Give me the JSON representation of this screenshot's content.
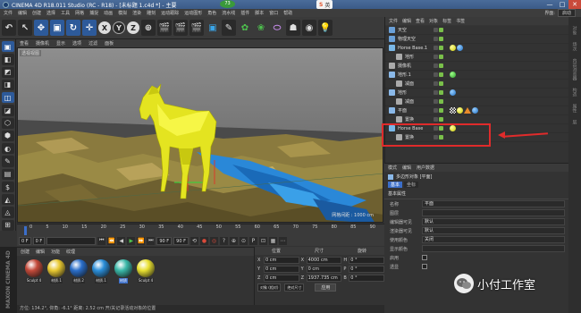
{
  "app": {
    "title": "CINEMA 4D R18.011 Studio (RC - R18) - [未标题 1.c4d *] - 主要",
    "fps_badge": "73"
  },
  "sogou": {
    "logo": "S",
    "lang": "英"
  },
  "window_buttons": {
    "minimize": "—",
    "maximize": "□",
    "close": "✕"
  },
  "menubar": {
    "items": [
      "文件",
      "编辑",
      "创建",
      "选择",
      "工具",
      "网格",
      "捕捉",
      "动画",
      "模拟",
      "渲染",
      "雕刻",
      "运动跟踪",
      "运动图形",
      "角色",
      "流水线",
      "插件",
      "脚本",
      "窗口",
      "帮助"
    ],
    "layout_label": "界面:",
    "layout_value": "启动"
  },
  "toolbar": {
    "buttons": [
      "↶",
      "↖",
      "✥",
      "▣",
      "↻",
      "✛",
      "X",
      "Y",
      "Z",
      "⊕",
      "🎬",
      "🎬",
      "🎬",
      "▣",
      "✎",
      "✿",
      "❀",
      "⬭",
      "☗",
      "◉",
      "💡"
    ]
  },
  "leftbar": {
    "icons": [
      "▣",
      "◧",
      "◩",
      "◨",
      "◫",
      "◪",
      "⬡",
      "⬢",
      "◐",
      "✎",
      "▤",
      "$",
      "◭",
      "◬",
      "⊞"
    ]
  },
  "viewport": {
    "menu": [
      "查看",
      "摄像机",
      "显示",
      "选项",
      "过滤",
      "面板"
    ],
    "label": "透视视图",
    "grid_info": "网格间距 : 1000 cm"
  },
  "timeline": {
    "ticks": [
      "0",
      "5",
      "10",
      "15",
      "20",
      "25",
      "30",
      "35",
      "40",
      "45",
      "50",
      "55",
      "60",
      "65",
      "70",
      "75",
      "80",
      "85",
      "90"
    ],
    "frame_marker": "0 F"
  },
  "transport": {
    "start": "0 F",
    "current": "0 F",
    "end": "90 F",
    "end2": "90 F",
    "buttons": [
      "⏮",
      "⏪",
      "◀",
      "▶",
      "⏩",
      "⏭",
      "⟲",
      "●",
      "◎",
      "?",
      "⊕",
      "⊙",
      "P",
      "⊡",
      "▦",
      "⋯"
    ]
  },
  "materials": {
    "menu": [
      "创建",
      "编辑",
      "功能",
      "纹理"
    ],
    "items": [
      {
        "label": "Sculpt 4",
        "color": "#c44a3a",
        "selected": false
      },
      {
        "label": "材质.1",
        "color": "#e8c830",
        "selected": false
      },
      {
        "label": "材质.2",
        "color": "#2a6ec9",
        "selected": false
      },
      {
        "label": "材质.1",
        "color": "#2a8ed9",
        "selected": false
      },
      {
        "label": "材质",
        "color": "#3ab8a8",
        "selected": true
      },
      {
        "label": "Sculpt 4",
        "color": "#e8e030",
        "selected": false
      }
    ],
    "brand": "MAXON CINEMA 4D"
  },
  "coords": {
    "headers": [
      "位置",
      "尺寸",
      "旋转"
    ],
    "rows": [
      {
        "axis": "X",
        "pos": "0 cm",
        "size": "4000 cm",
        "rot_axis": "H",
        "rot": "0 °"
      },
      {
        "axis": "Y",
        "pos": "0 cm",
        "size": "0 cm",
        "rot_axis": "P",
        "rot": "0 °"
      },
      {
        "axis": "Z",
        "pos": "0 cm",
        "size": "1937.735 cm",
        "rot_axis": "B",
        "rot": "0 °"
      }
    ],
    "mode": "对象 (相对)",
    "size_mode": "绝对尺寸",
    "apply": "应用"
  },
  "statusbar": "方位: 134.2°, 仰角: -6.1°  距离: 2.52 cm  开/关记录活动对象的位置",
  "objects": {
    "menu": [
      "文件",
      "编辑",
      "查看",
      "对象",
      "标签",
      "书签"
    ],
    "rows": [
      {
        "name": "天空",
        "indent": 0,
        "icon": "#6aa0d8",
        "tags": []
      },
      {
        "name": "物理天空",
        "indent": 0,
        "icon": "#6aa0d8",
        "tags": []
      },
      {
        "name": "Horse Base.1",
        "indent": 0,
        "icon": "#7ab8e8",
        "tags": [
          "yel",
          "blu"
        ]
      },
      {
        "name": "地形",
        "indent": 1,
        "icon": "#aaa",
        "tags": []
      },
      {
        "name": "摄像机",
        "indent": 0,
        "icon": "#aaa",
        "tags": []
      },
      {
        "name": "地形.1",
        "indent": 0,
        "icon": "#8ab8e8",
        "tags": [
          "grn"
        ]
      },
      {
        "name": "减面",
        "indent": 1,
        "icon": "#aaa",
        "tags": []
      },
      {
        "name": "地形",
        "indent": 0,
        "icon": "#8ab8e8",
        "tags": [
          "blu"
        ]
      },
      {
        "name": "减面",
        "indent": 1,
        "icon": "#aaa",
        "tags": []
      },
      {
        "name": "平面",
        "indent": 0,
        "icon": "#8ab8e8",
        "tags": [
          "chk",
          "yel",
          "tri",
          "blu"
        ]
      },
      {
        "name": "置换",
        "indent": 1,
        "icon": "#aaa",
        "tags": []
      },
      {
        "name": "Horse Base",
        "indent": 0,
        "icon": "#7ab8e8",
        "tags": [
          "yel"
        ]
      },
      {
        "name": "置换",
        "indent": 1,
        "icon": "#aaa",
        "tags": []
      }
    ]
  },
  "side_tabs": [
    "对象",
    "场次",
    "内容浏览器",
    "构造",
    "属性",
    "层"
  ],
  "attributes": {
    "menu": [
      "模式",
      "编辑",
      "用户数据"
    ],
    "object_label": "多边形对象 [平面]",
    "tabs": [
      {
        "label": "基本",
        "on": true
      },
      {
        "label": "坐标",
        "on": false
      }
    ],
    "section": "基本属性",
    "rows": [
      {
        "label": "名称",
        "value": "平面"
      },
      {
        "label": "图层",
        "value": ""
      },
      {
        "label": "编辑器可见",
        "value": "默认"
      },
      {
        "label": "渲染器可见",
        "value": "默认"
      },
      {
        "label": "使用颜色",
        "value": "关闭"
      },
      {
        "label": "显示颜色",
        "value": ""
      },
      {
        "label": "启用",
        "value": "check"
      },
      {
        "label": "透显",
        "value": "check"
      }
    ]
  },
  "watermark": {
    "name": "小付工作室"
  },
  "annotation": {
    "color": "#e02b2b"
  }
}
